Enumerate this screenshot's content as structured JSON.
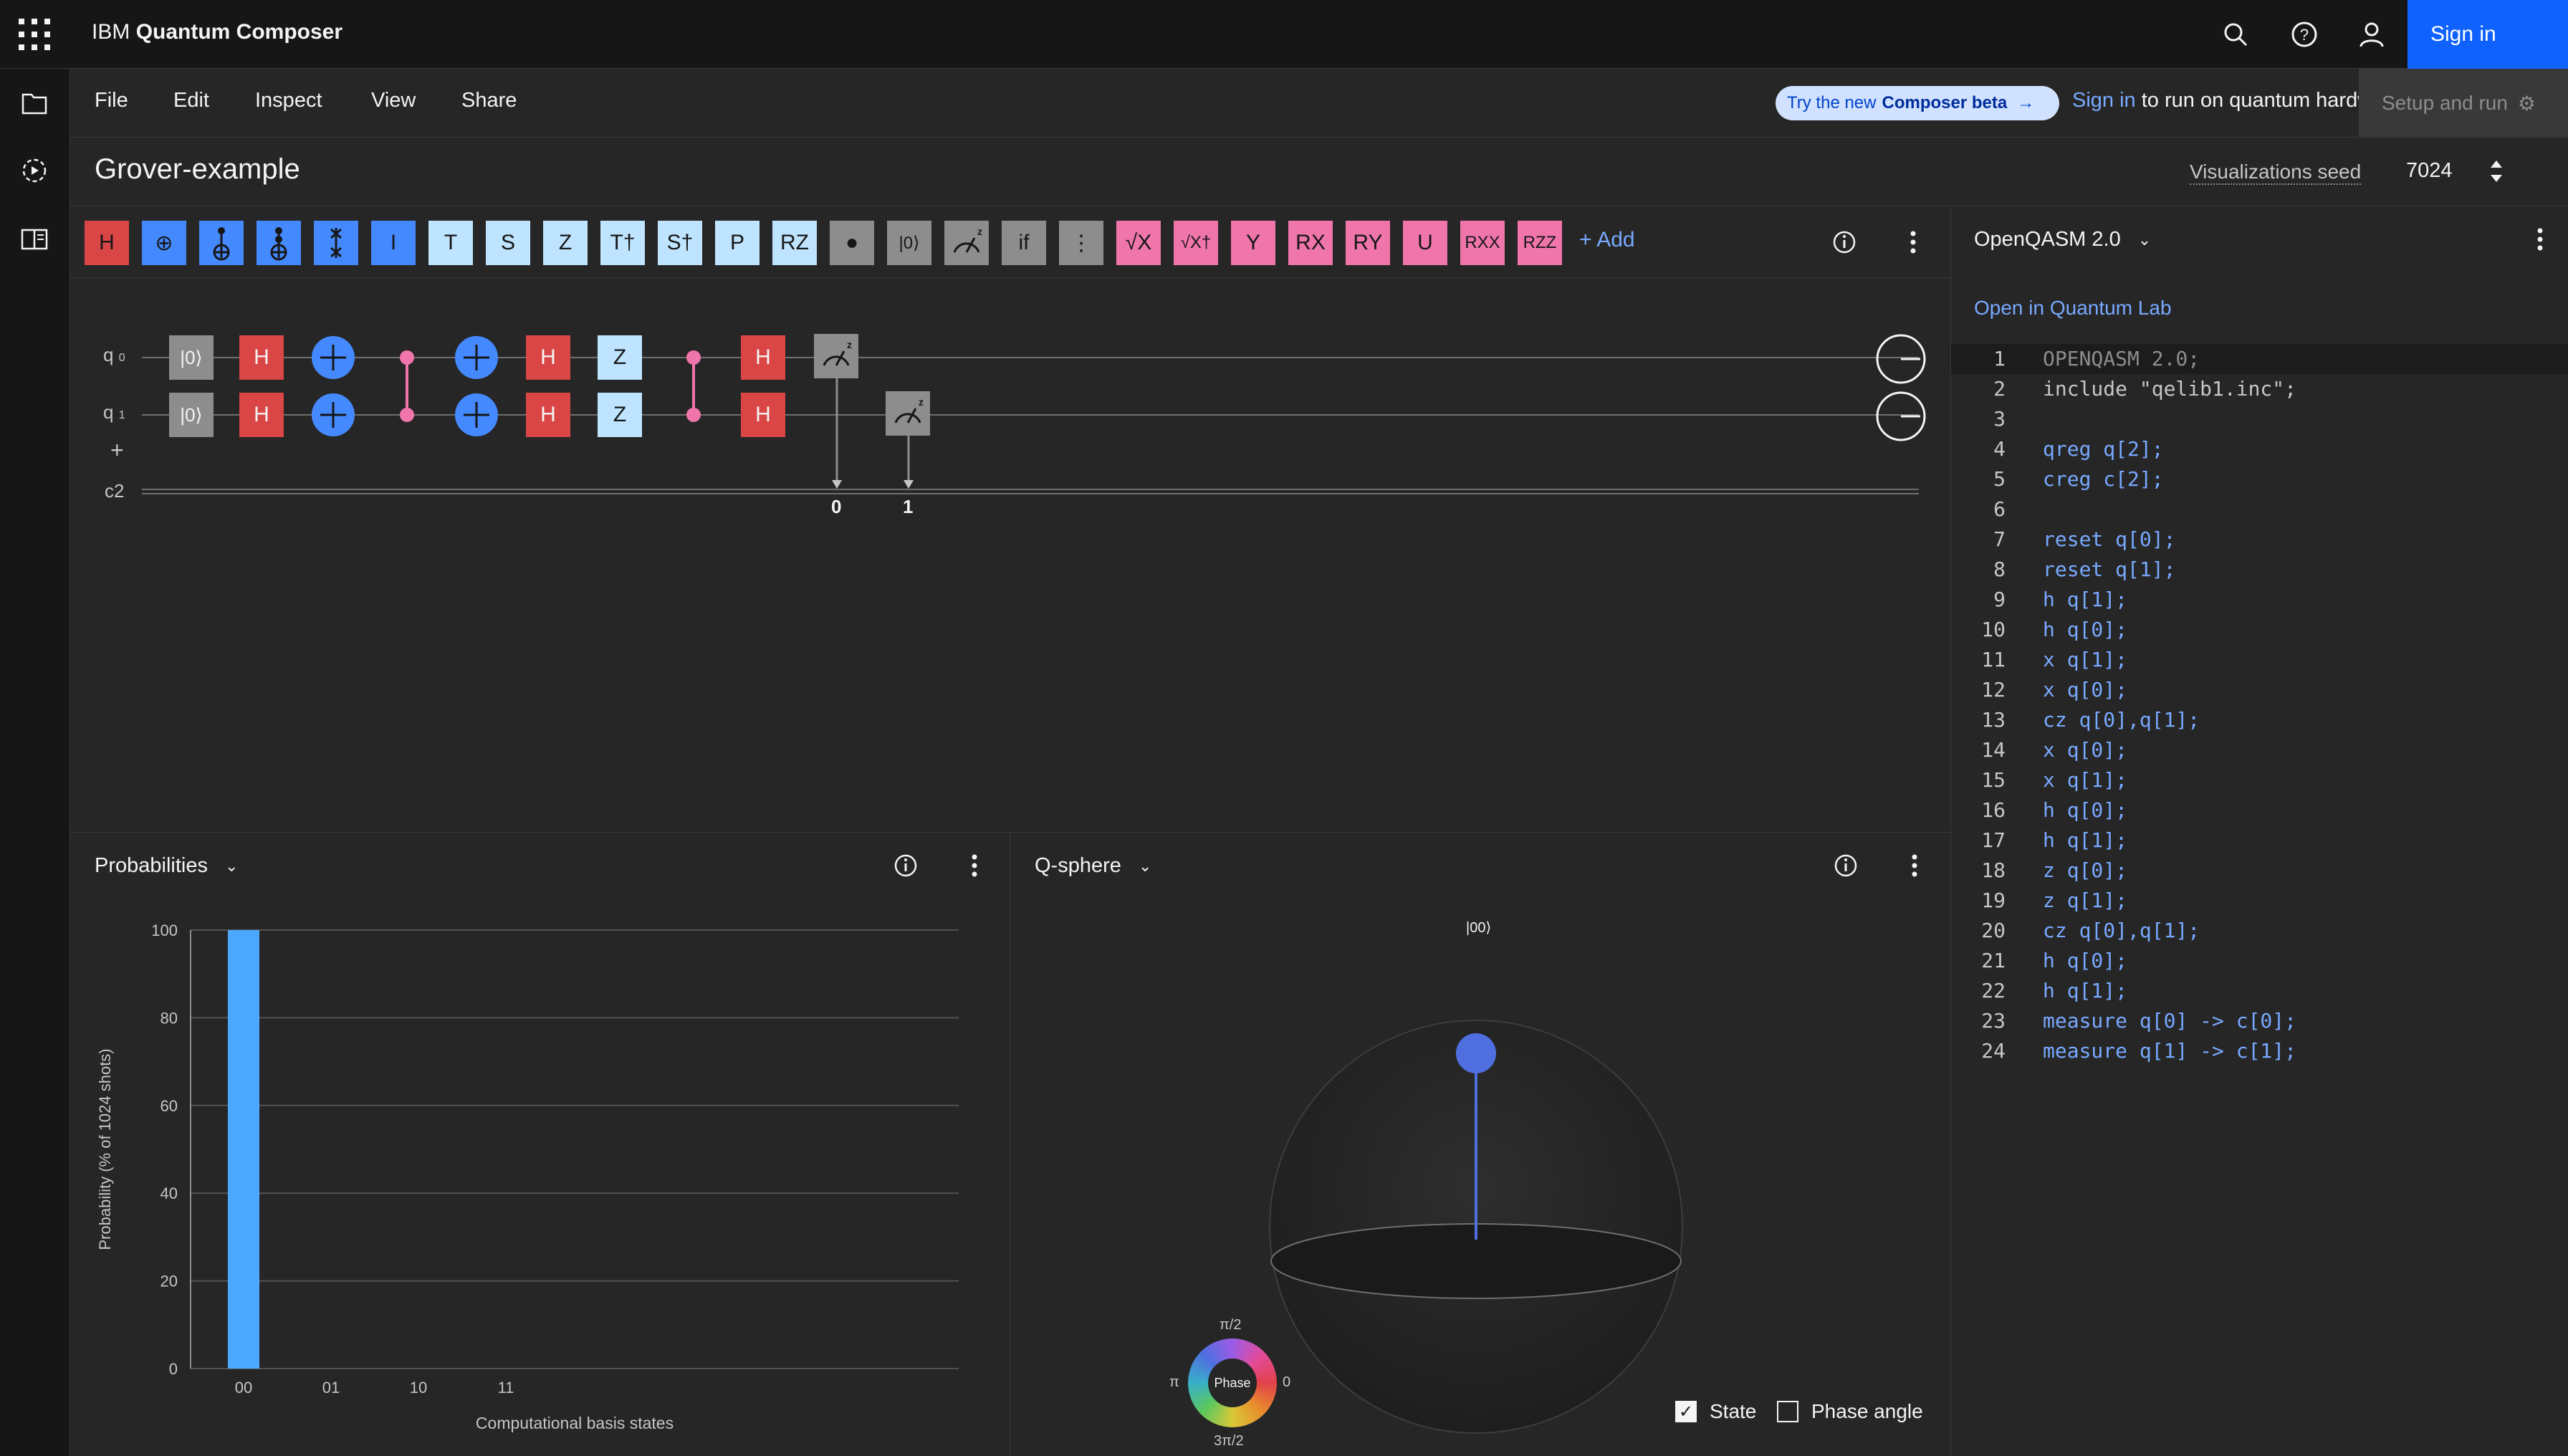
{
  "app": {
    "brand_prefix": "IBM",
    "brand_name": "Quantum Composer",
    "signin_label": "Sign in"
  },
  "menu": {
    "items": [
      "File",
      "Edit",
      "Inspect",
      "View",
      "Share"
    ],
    "beta_prefix": "Try the new",
    "beta_name": "Composer beta",
    "hw_signin": "Sign in",
    "hw_text": " to run on quantum hardware.",
    "setup_label": "Setup and run"
  },
  "title": {
    "name": "Grover-example",
    "seed_label": "Visualizations seed",
    "seed_value": "7024"
  },
  "palette": {
    "gates": [
      {
        "label": "H",
        "kind": "h"
      },
      {
        "label": "⊕",
        "kind": "cx"
      },
      {
        "label": "",
        "kind": "ccx"
      },
      {
        "label": "",
        "kind": "cccx"
      },
      {
        "label": "",
        "kind": "swap"
      },
      {
        "label": "I",
        "kind": "i"
      },
      {
        "label": "T",
        "kind": "light"
      },
      {
        "label": "S",
        "kind": "light"
      },
      {
        "label": "Z",
        "kind": "light"
      },
      {
        "label": "T†",
        "kind": "light"
      },
      {
        "label": "S†",
        "kind": "light"
      },
      {
        "label": "P",
        "kind": "light"
      },
      {
        "label": "RZ",
        "kind": "light"
      },
      {
        "label": "●",
        "kind": "gray"
      },
      {
        "label": "|0⟩",
        "kind": "gray"
      },
      {
        "label": "",
        "kind": "measure"
      },
      {
        "label": "if",
        "kind": "gray"
      },
      {
        "label": "⋮",
        "kind": "gray"
      },
      {
        "label": "√X",
        "kind": "pink"
      },
      {
        "label": "√X†",
        "kind": "pink"
      },
      {
        "label": "Y",
        "kind": "pink"
      },
      {
        "label": "RX",
        "kind": "pink"
      },
      {
        "label": "RY",
        "kind": "pink"
      },
      {
        "label": "U",
        "kind": "pink"
      },
      {
        "label": "RXX",
        "kind": "pink"
      },
      {
        "label": "RZZ",
        "kind": "pink"
      }
    ],
    "add_label": "+ Add"
  },
  "circuit": {
    "q0_label": "q",
    "q0_sub": "0",
    "q1_label": "q",
    "q1_sub": "1",
    "add_qubit": "+",
    "creg_label": "c2",
    "reset_label": "|0⟩",
    "h_label": "H",
    "z_label": "Z",
    "bit0": "0",
    "bit1": "1"
  },
  "code": {
    "language": "OpenQASM 2.0",
    "open_lab": "Open in Quantum Lab",
    "lines": [
      "OPENQASM 2.0;",
      "include \"qelib1.inc\";",
      "",
      "qreg q[2];",
      "creg c[2];",
      "",
      "reset q[0];",
      "reset q[1];",
      "h q[1];",
      "h q[0];",
      "x q[1];",
      "x q[0];",
      "cz q[0],q[1];",
      "x q[0];",
      "x q[1];",
      "h q[0];",
      "h q[1];",
      "z q[0];",
      "z q[1];",
      "cz q[0],q[1];",
      "h q[0];",
      "h q[1];",
      "measure q[0] -> c[0];",
      "measure q[1] -> c[1];"
    ],
    "line_numbers": [
      "1",
      "2",
      "3",
      "4",
      "5",
      "6",
      "7",
      "8",
      "9",
      "10",
      "11",
      "12",
      "13",
      "14",
      "15",
      "16",
      "17",
      "18",
      "19",
      "20",
      "21",
      "22",
      "23",
      "24"
    ]
  },
  "probabilities": {
    "title": "Probabilities"
  },
  "chart_data": {
    "type": "bar",
    "categories": [
      "00",
      "01",
      "10",
      "11"
    ],
    "values": [
      100,
      0,
      0,
      0
    ],
    "title": "",
    "xlabel": "Computational basis states",
    "ylabel": "Probability (% of 1024 shots)",
    "ylim": [
      0,
      100
    ],
    "yticks": [
      "0",
      "20",
      "40",
      "60",
      "80",
      "100"
    ],
    "grid": true,
    "bar_color": "#4aa8ff"
  },
  "qsphere": {
    "title": "Q-sphere",
    "state_label": "|00⟩",
    "phase_top": "π/2",
    "phase_bottom": "3π/2",
    "phase_left": "π",
    "phase_right": "0",
    "phase_center": "Phase",
    "state_checkbox": "State",
    "phase_angle_checkbox": "Phase angle",
    "state_checked": true,
    "phase_angle_checked": false
  },
  "colors": {
    "h": "#da4646",
    "blue": "#4589ff",
    "light": "#bee4ff",
    "gray": "#8d8d8d",
    "pink": "#f075ab",
    "accent": "#0f62fe",
    "link": "#78a9ff"
  }
}
